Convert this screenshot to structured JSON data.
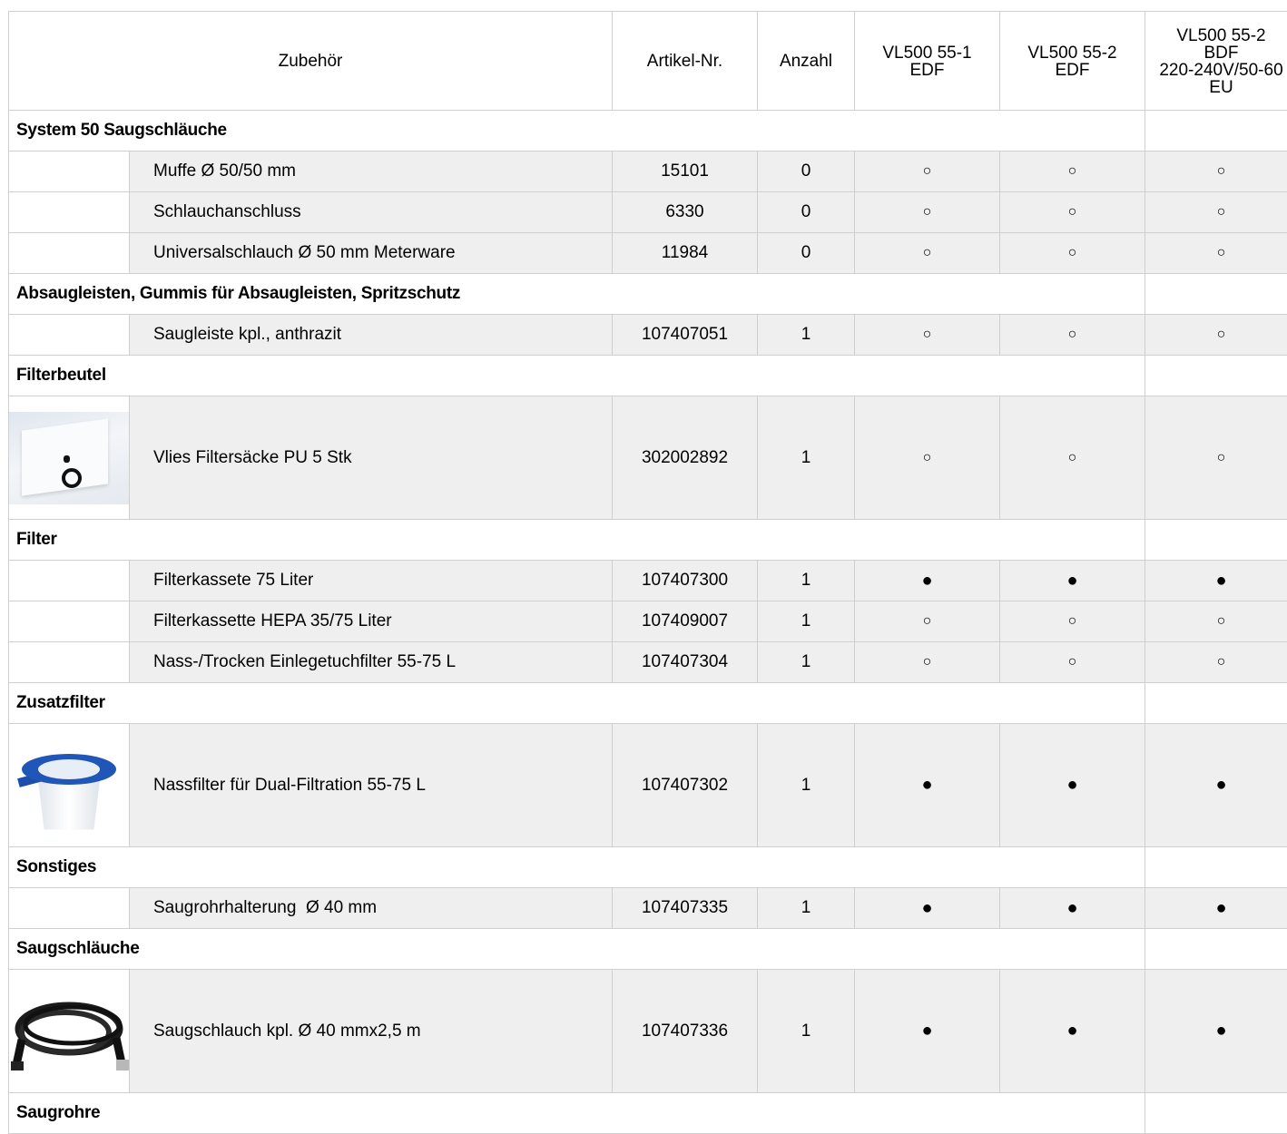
{
  "header": {
    "zubehoer": "Zubehör",
    "artikel": "Artikel-Nr.",
    "anzahl": "Anzahl",
    "m1_line1": "VL500 55-1",
    "m1_line2": "EDF",
    "m2_line1": "VL500 55-2",
    "m2_line2": "EDF",
    "m3_line1": "VL500 55-2",
    "m3_line2": "BDF",
    "m3_line3": "220-240V/50-60",
    "m3_line4": "EU"
  },
  "groups": [
    {
      "title": "System 50 Saugschläuche",
      "items": [
        {
          "name": "Muffe Ø 50/50 mm",
          "article": "15101",
          "qty": "0",
          "m1": "○",
          "m2": "○",
          "m3": "○"
        },
        {
          "name": "Schlauchanschluss",
          "article": "6330",
          "qty": "0",
          "m1": "○",
          "m2": "○",
          "m3": "○"
        },
        {
          "name": "Universalschlauch Ø 50 mm Meterware",
          "article": "11984",
          "qty": "0",
          "m1": "○",
          "m2": "○",
          "m3": "○"
        }
      ]
    },
    {
      "title": "Absaugleisten, Gummis für Absaugleisten, Spritzschutz",
      "items": [
        {
          "name": "Saugleiste kpl., anthrazit",
          "article": "107407051",
          "qty": "1",
          "m1": "○",
          "m2": "○",
          "m3": "○"
        }
      ]
    },
    {
      "title": "Filterbeutel",
      "items": [
        {
          "name": "Vlies Filtersäcke PU 5 Stk",
          "article": "302002892",
          "qty": "1",
          "m1": "○",
          "m2": "○",
          "m3": "○",
          "image": "filter-bag"
        }
      ]
    },
    {
      "title": "Filter",
      "items": [
        {
          "name": "Filterkassete 75 Liter",
          "article": "107407300",
          "qty": "1",
          "m1": "●",
          "m2": "●",
          "m3": "●"
        },
        {
          "name": "Filterkassette HEPA 35/75 Liter",
          "article": "107409007",
          "qty": "1",
          "m1": "○",
          "m2": "○",
          "m3": "○"
        },
        {
          "name": "Nass-/Trocken Einlegetuchfilter 55-75 L",
          "article": "107407304",
          "qty": "1",
          "m1": "○",
          "m2": "○",
          "m3": "○"
        }
      ]
    },
    {
      "title": "Zusatzfilter",
      "items": [
        {
          "name": "Nassfilter für Dual-Filtration 55-75 L",
          "article": "107407302",
          "qty": "1",
          "m1": "●",
          "m2": "●",
          "m3": "●",
          "image": "wet-filter"
        }
      ]
    },
    {
      "title": "Sonstiges",
      "items": [
        {
          "name": "Saugrohrhalterung  Ø 40 mm",
          "article": "107407335",
          "qty": "1",
          "m1": "●",
          "m2": "●",
          "m3": "●"
        }
      ]
    },
    {
      "title": "Saugschläuche",
      "items": [
        {
          "name": "Saugschlauch kpl. Ø 40 mmx2,5 m",
          "article": "107407336",
          "qty": "1",
          "m1": "●",
          "m2": "●",
          "m3": "●",
          "image": "suction-hose"
        }
      ]
    },
    {
      "title": "Saugrohre",
      "items": []
    }
  ]
}
